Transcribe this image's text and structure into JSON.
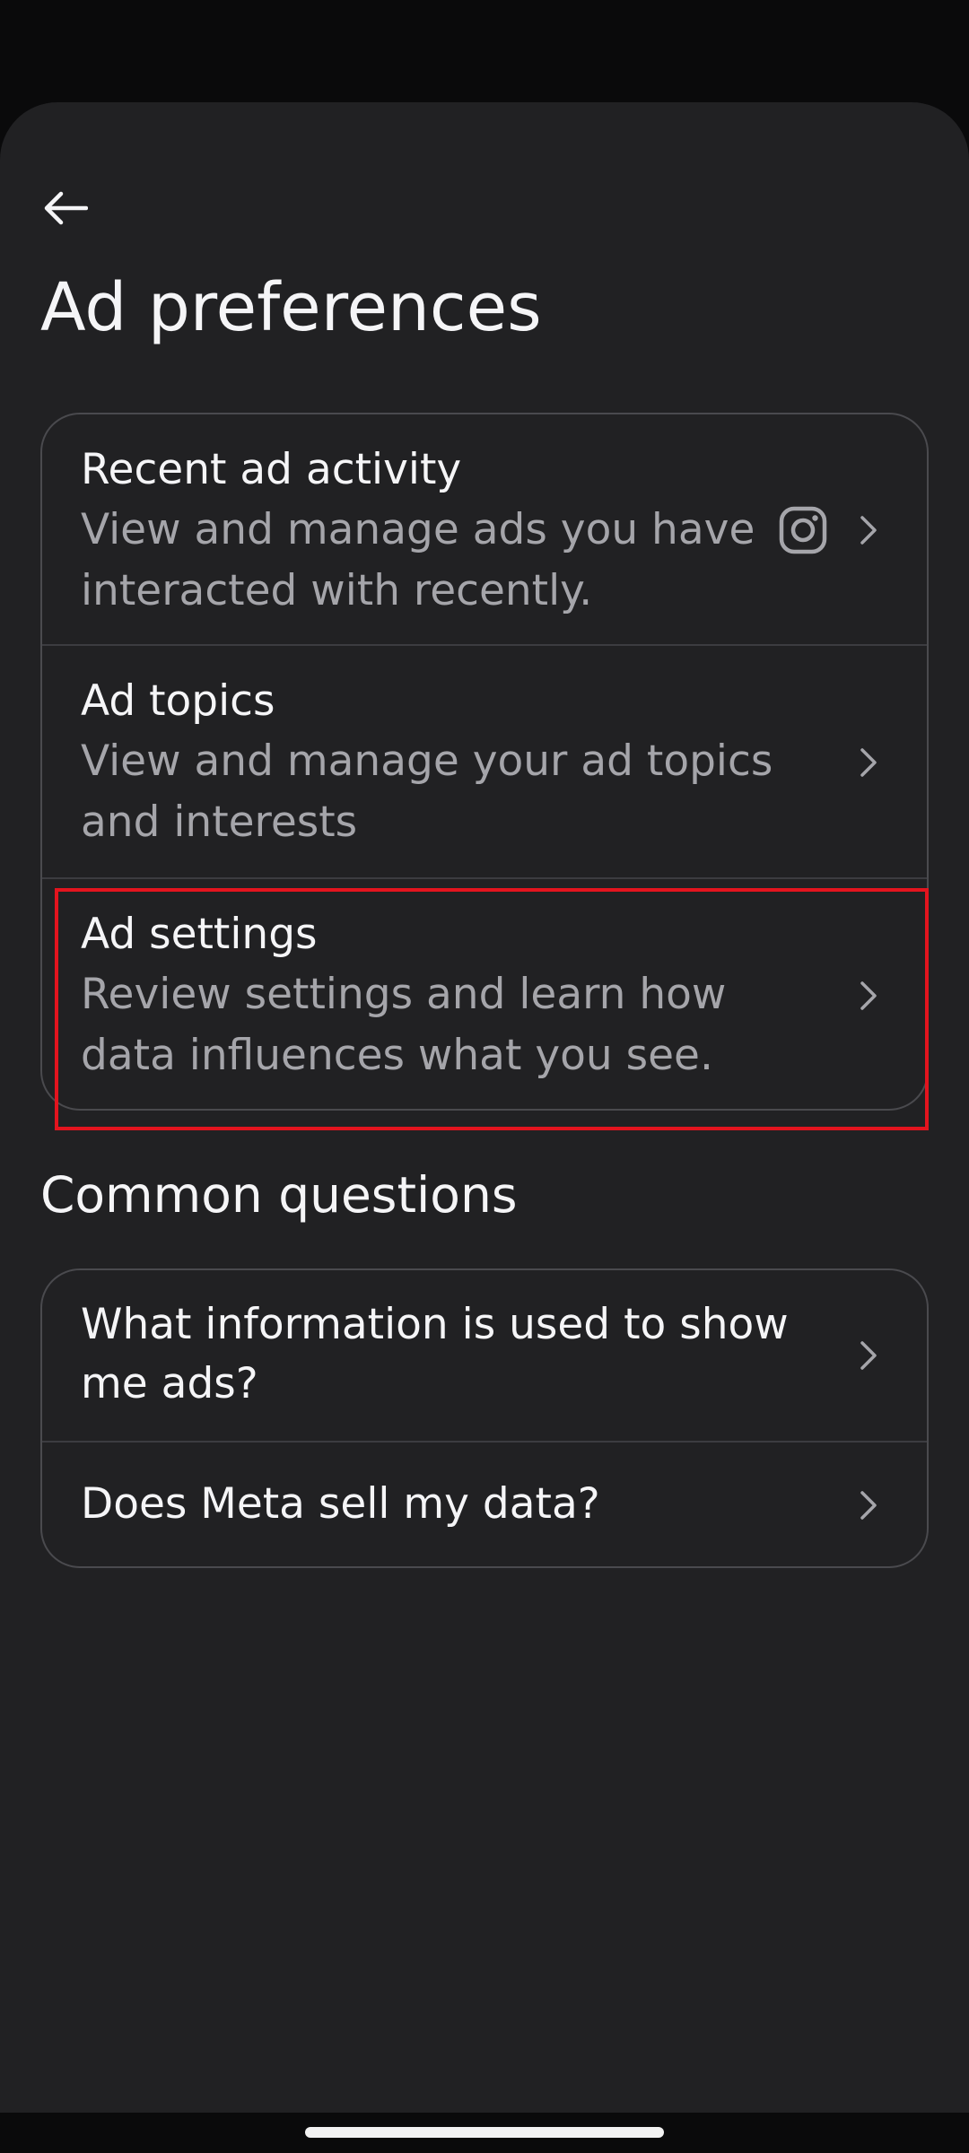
{
  "header": {
    "back_icon": "arrow-left-icon",
    "title": "Ad preferences"
  },
  "main_list": {
    "items": [
      {
        "title": "Recent ad activity",
        "description": "View and manage ads you have interacted with recently.",
        "icon": "instagram-icon"
      },
      {
        "title": "Ad topics",
        "description": "View and manage your ad topics and interests"
      },
      {
        "title": "Ad settings",
        "description": "Review settings and learn how data influences what you see."
      }
    ]
  },
  "common_questions": {
    "heading": "Common questions",
    "items": [
      {
        "question": "What information is used to show me ads?"
      },
      {
        "question": "Does Meta sell my data?"
      }
    ]
  },
  "colors": {
    "background": "#212123",
    "text_primary": "#f5f5f7",
    "text_secondary": "#a5a5aa",
    "border": "#4a4a4e",
    "highlight": "#e3141e"
  }
}
